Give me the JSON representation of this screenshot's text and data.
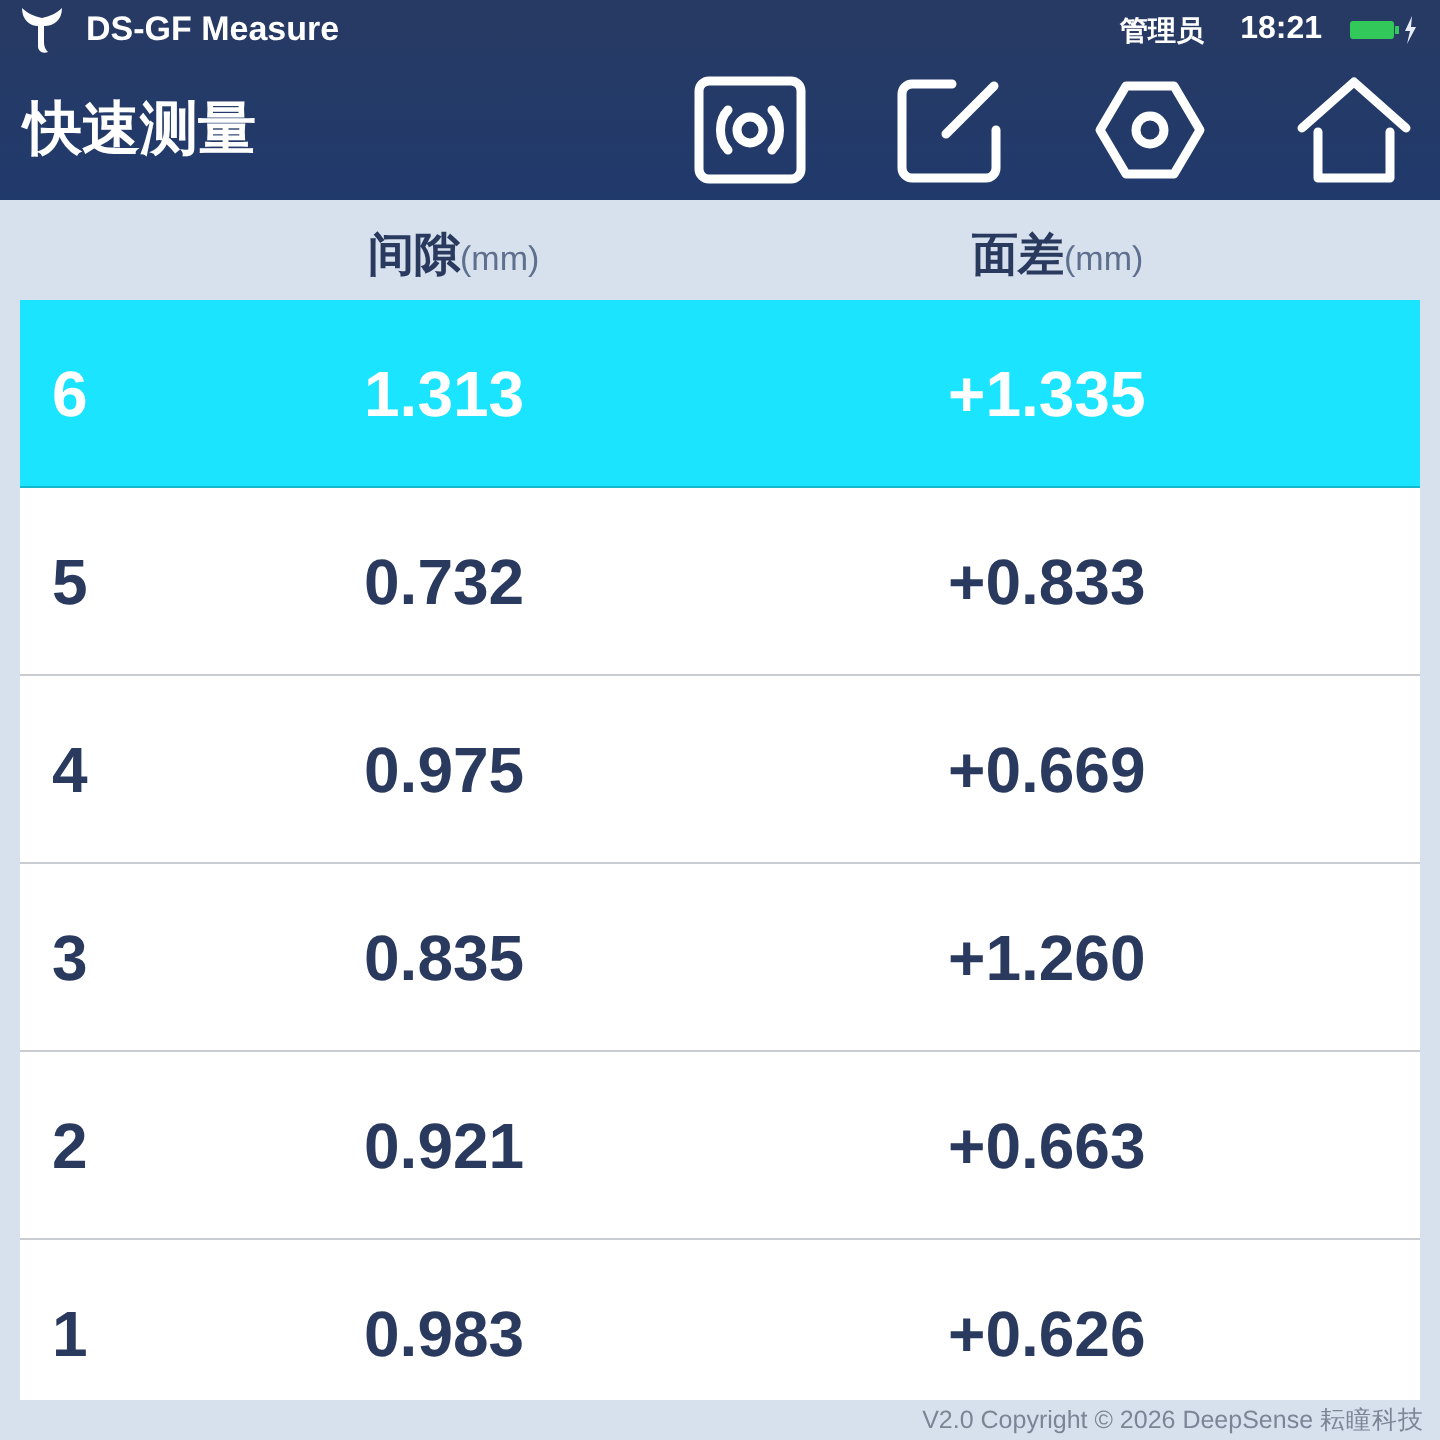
{
  "status_bar": {
    "app_title": "DS-GF Measure",
    "user": "管理员",
    "time": "18:21"
  },
  "header": {
    "title": "快速测量"
  },
  "columns": [
    {
      "label": "间隙",
      "unit": "(mm)"
    },
    {
      "label": "面差",
      "unit": "(mm)"
    }
  ],
  "rows": [
    {
      "cells": [
        "6",
        "1.313",
        "+1.335"
      ],
      "selected": true
    },
    {
      "cells": [
        "5",
        "0.732",
        "+0.833"
      ],
      "selected": false
    },
    {
      "cells": [
        "4",
        "0.975",
        "+0.669"
      ],
      "selected": false
    },
    {
      "cells": [
        "3",
        "0.835",
        "+1.260"
      ],
      "selected": false
    },
    {
      "cells": [
        "2",
        "0.921",
        "+0.663"
      ],
      "selected": false
    },
    {
      "cells": [
        "1",
        "0.983",
        "+0.626"
      ],
      "selected": false
    }
  ],
  "footer": "V2.0 Copyright © 2026 DeepSense 耘瞳科技"
}
